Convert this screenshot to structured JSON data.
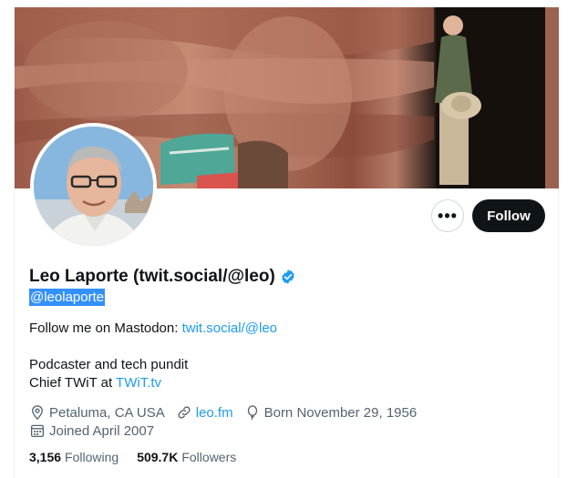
{
  "profile": {
    "display_name": "Leo Laporte (twit.social/@leo)",
    "handle": "@leolaporte",
    "bio_line1_text": "Follow me on Mastodon: ",
    "bio_line1_link": "twit.social/@leo",
    "bio_line2": "Podcaster and tech pundit",
    "bio_line3_text": "Chief TWiT at ",
    "bio_line3_link": "TWiT.tv",
    "location": "Petaluma, CA USA",
    "website": "leo.fm",
    "birthday": "Born November 29, 1956",
    "joined": "Joined April 2007",
    "following_count": "3,156",
    "following_label": "Following",
    "followers_count": "509.7K",
    "followers_label": "Followers"
  },
  "actions": {
    "more_label": "•••",
    "follow_label": "Follow"
  },
  "icons": {
    "verified": "verified-badge-icon",
    "location": "location-pin-icon",
    "website": "link-icon",
    "birthday": "balloon-icon",
    "joined": "calendar-icon",
    "more": "more-dots-icon"
  },
  "colors": {
    "accent": "#1d9bf0",
    "primary_text": "#0f1419",
    "secondary_text": "#536471",
    "follow_button": "#0f1419",
    "selection": "#3390ff"
  }
}
